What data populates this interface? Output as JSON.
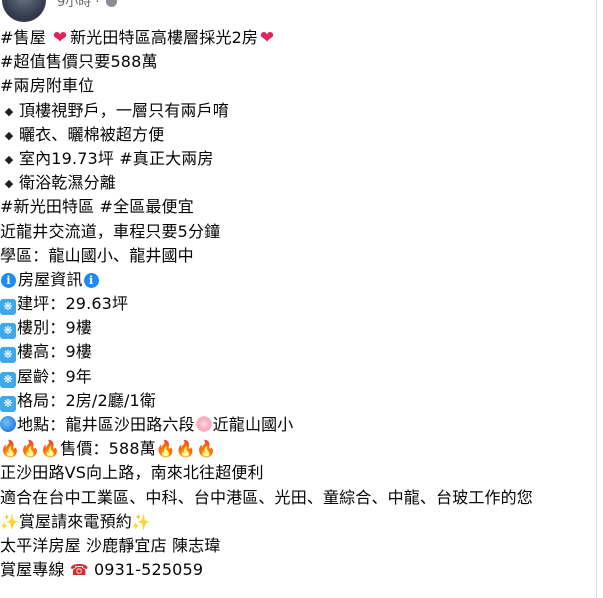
{
  "header": {
    "time": "9小時"
  },
  "icons": {
    "heart": "❤",
    "diamond": "◆",
    "info": "i",
    "snow": "❋",
    "fire": "🔥",
    "sparkle": "✨",
    "phone": "☎"
  },
  "post": {
    "l1": "#售屋 ",
    "l1b": "新光田特區高樓層採光2房",
    "l2": "#超值售價只要588萬",
    "l3": "#兩房附車位",
    "l4": "頂樓視野戶，一層只有兩戶唷",
    "l5": "曬衣、曬棉被超方便",
    "l6": "室內19.73坪 #真正大兩房",
    "l7": "衛浴乾濕分離",
    "l8": "#新光田特區 #全區最便宜",
    "l9": "近龍井交流道，車程只要5分鐘",
    "l10": "學區：龍山國小、龍井國中",
    "l11": "房屋資訊",
    "l12": "建坪：29.63坪",
    "l13": "樓別：9樓",
    "l14": "樓高：9樓",
    "l15": "屋齡：9年",
    "l16": "格局：2房/2廳/1衛",
    "l17a": "地點：龍井區沙田路六段",
    "l17b": "近龍山國小",
    "l18": "售價：588萬",
    "l19": "正沙田路VS向上路，南來北往超便利",
    "l20": "適合在台中工業區、中科、台中港區、光田、童綜合、中龍、台玻工作的您",
    "l21": "賞屋請來電預約",
    "l22": "太平洋房屋 沙鹿靜宜店 陳志瑋",
    "l23": "賞屋專線 ",
    "l23b": "0931-525059"
  }
}
